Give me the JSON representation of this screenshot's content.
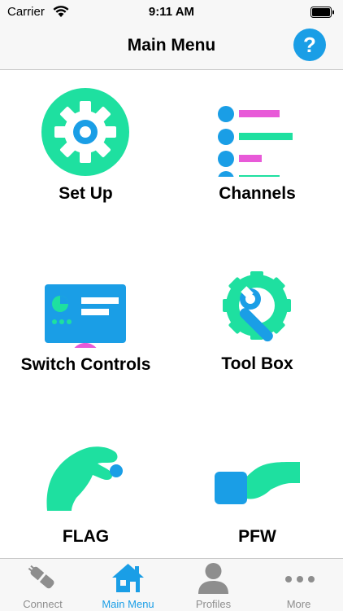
{
  "status_bar": {
    "carrier": "Carrier",
    "time": "9:11 AM"
  },
  "nav": {
    "title": "Main Menu",
    "help_label": "?"
  },
  "menu": {
    "setup": "Set Up",
    "channels": "Channels",
    "switch_controls": "Switch Controls",
    "tool_box": "Tool Box",
    "flag": "FLAG",
    "pfw": "PFW"
  },
  "tabs": {
    "connect": "Connect",
    "main_menu": "Main Menu",
    "profiles": "Profiles",
    "more": "More"
  },
  "colors": {
    "green": "#1ee0a0",
    "blue": "#1a9ee6",
    "pink": "#e85ad8",
    "active_tab": "#1a9ee6",
    "inactive_tab": "#8e8e8e"
  }
}
